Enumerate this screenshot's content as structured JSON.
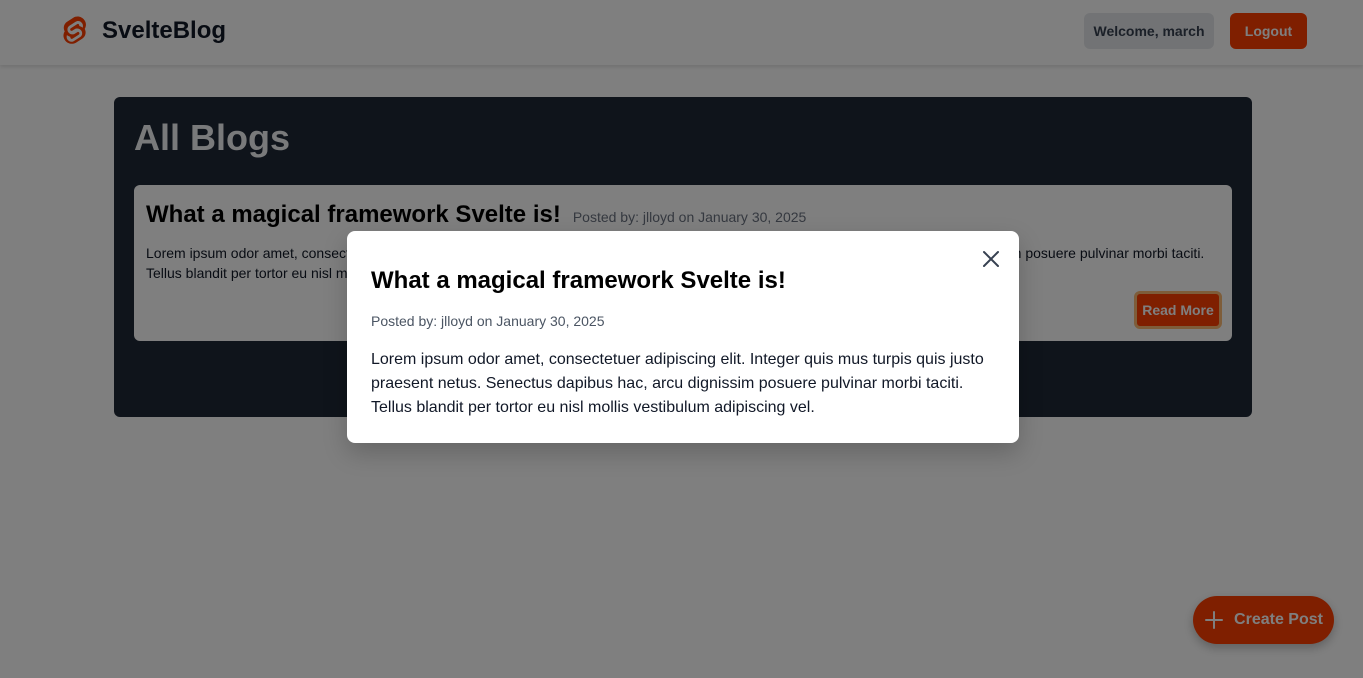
{
  "navbar": {
    "brand": "SvelteBlog",
    "logo_icon": "svelte-logo-icon",
    "welcome": "Welcome, march",
    "logout_label": "Logout"
  },
  "main": {
    "title": "All Blogs",
    "posts": [
      {
        "title": "What a magical framework Svelte is!",
        "meta": "Posted by: jlloyd on January 30, 2025",
        "excerpt": "Lorem ipsum odor amet, consectetuer adipiscing elit. Integer quis mus turpis quis justo praesent netus. Senectus dapibus hac, arcu dignissim posuere pulvinar morbi taciti. Tellus blandit per tortor eu nisl mollis vestibulum adipiscing vel.",
        "read_more_label": "Read More"
      }
    ]
  },
  "fab": {
    "label": "Create Post",
    "icon": "plus-icon"
  },
  "modal": {
    "title": "What a magical framework Svelte is!",
    "meta": "Posted by: jlloyd on January 30, 2025",
    "body": "Lorem ipsum odor amet, consectetuer adipiscing elit. Integer quis mus turpis quis justo praesent netus. Senectus dapibus hac, arcu dignissim posuere pulvinar morbi taciti. Tellus blandit per tortor eu nisl mollis vestibulum adipiscing vel.",
    "close_icon": "close-icon"
  },
  "colors": {
    "accent": "#ff3e00",
    "panel_bg": "#1f2937",
    "overlay": "rgba(0,0,0,0.5)"
  }
}
